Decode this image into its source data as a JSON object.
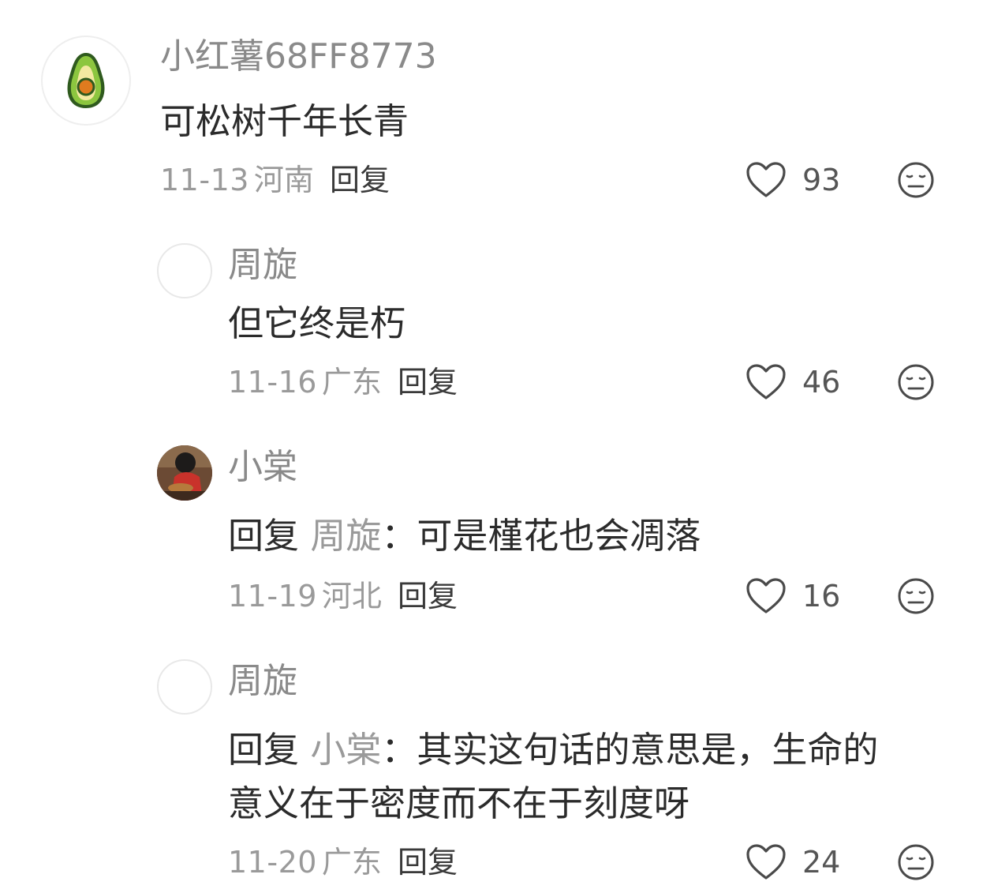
{
  "comments": [
    {
      "username": "小红薯68FF8773",
      "text": "可松树千年长青",
      "date": "11-13",
      "location": "河南",
      "reply_label": "回复",
      "likes": "93",
      "avatar_icon": "avocado-icon"
    },
    {
      "username": "周旋",
      "text": "但它终是朽",
      "date": "11-16",
      "location": "广东",
      "reply_label": "回复",
      "likes": "46",
      "avatar_icon": "blank-avatar"
    },
    {
      "username": "小棠",
      "reply_prefix": "回复",
      "reply_target": "周旋",
      "reply_colon": "：",
      "text": "可是槿花也会凋落",
      "date": "11-19",
      "location": "河北",
      "reply_label": "回复",
      "likes": "16",
      "avatar_icon": "photo-avatar"
    },
    {
      "username": "周旋",
      "reply_prefix": "回复",
      "reply_target": "小棠",
      "reply_colon": "：",
      "text": "其实这句话的意思是，生命的",
      "text_line2": "意义在于密度而不在于刻度呀",
      "date": "11-20",
      "location": "广东",
      "reply_label": "回复",
      "likes": "24",
      "avatar_icon": "blank-avatar"
    }
  ],
  "colors": {
    "text": "#2b2b2b",
    "muted": "#9a9a9a",
    "username": "#8a8a8a",
    "avocado_green": "#8cc63f",
    "avocado_flesh": "#f3e9a0",
    "avocado_pit": "#e07b1f"
  }
}
